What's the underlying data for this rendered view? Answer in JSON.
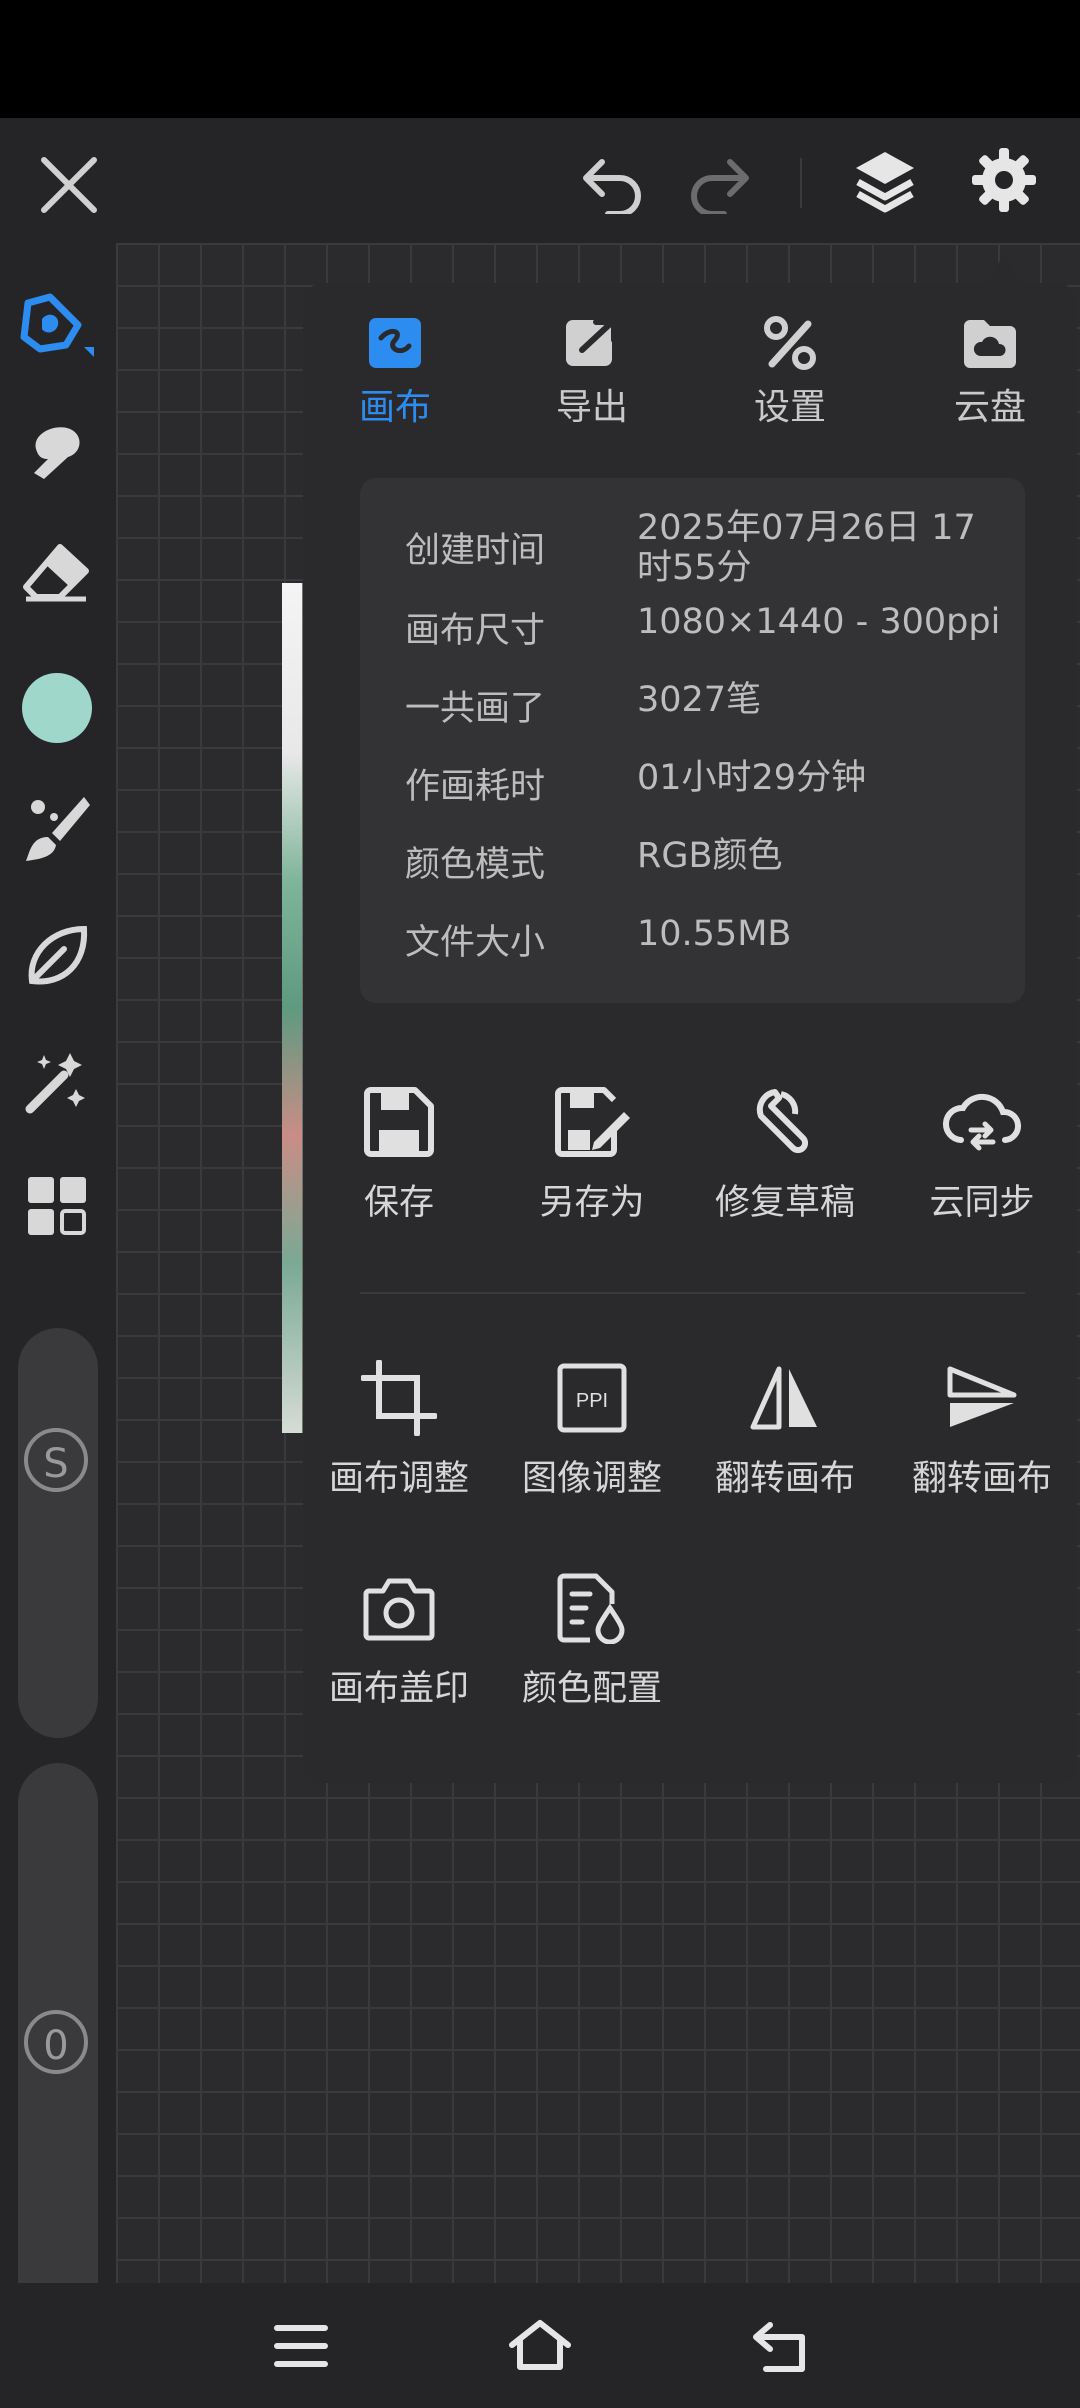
{
  "tabs": [
    {
      "label": "画布",
      "icon": "canvas-tab-icon",
      "active": true
    },
    {
      "label": "导出",
      "icon": "export-icon",
      "active": false
    },
    {
      "label": "设置",
      "icon": "tools-icon",
      "active": false
    },
    {
      "label": "云盘",
      "icon": "cloud-drive-icon",
      "active": false
    }
  ],
  "info": [
    {
      "key": "创建时间",
      "value": "2025年07月26日 17时55分"
    },
    {
      "key": "画布尺寸",
      "value": "1080×1440 - 300ppi"
    },
    {
      "key": "一共画了",
      "value": "3027笔"
    },
    {
      "key": "作画耗时",
      "value": "01小时29分钟"
    },
    {
      "key": "颜色模式",
      "value": "RGB颜色"
    },
    {
      "key": "文件大小",
      "value": "10.55MB"
    }
  ],
  "actions_row1": [
    {
      "label": "保存",
      "icon": "save-icon"
    },
    {
      "label": "另存为",
      "icon": "save-as-icon"
    },
    {
      "label": "修复草稿",
      "icon": "wrench-icon"
    },
    {
      "label": "云同步",
      "icon": "cloud-sync-icon"
    }
  ],
  "actions_row2": [
    {
      "label": "画布调整",
      "icon": "crop-icon"
    },
    {
      "label": "图像调整",
      "icon": "ppi-icon"
    },
    {
      "label": "翻转画布",
      "icon": "flip-horizontal-icon"
    },
    {
      "label": "翻转画布",
      "icon": "flip-vertical-icon"
    }
  ],
  "actions_row3": [
    {
      "label": "画布盖印",
      "icon": "camera-icon"
    },
    {
      "label": "颜色配置",
      "icon": "color-config-icon"
    }
  ],
  "sidebar": {
    "size_badge": "S",
    "opacity_badge": "0",
    "current_color": "#9fd8cb"
  },
  "colors": {
    "accent": "#2d8cf0",
    "panel": "#2a2a2d",
    "toolbar": "#252528"
  }
}
